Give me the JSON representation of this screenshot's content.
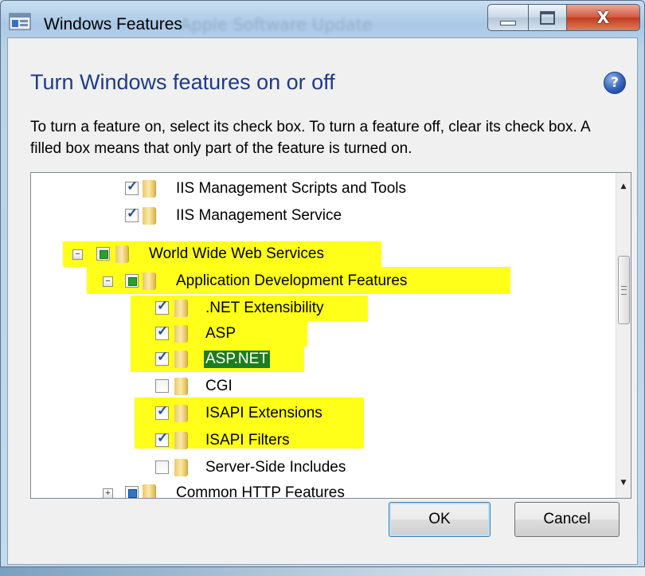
{
  "window": {
    "title": "Windows Features",
    "background_title": "Apple Software Update"
  },
  "dialog": {
    "heading": "Turn Windows features on or off",
    "description": "To turn a feature on, select its check box. To turn a feature off, clear its check box. A filled box means that only part of the feature is turned on."
  },
  "tree": {
    "items": [
      {
        "label": "IIS Management Scripts and Tools",
        "state": "checked"
      },
      {
        "label": "IIS Management Service",
        "state": "checked"
      },
      {
        "label": "World Wide Web Services",
        "state": "partial",
        "expander": "⊟"
      },
      {
        "label": "Application Development Features",
        "state": "partial",
        "expander": "⊟"
      },
      {
        "label": ".NET Extensibility",
        "state": "checked"
      },
      {
        "label": "ASP",
        "state": "checked"
      },
      {
        "label": "ASP.NET",
        "state": "checked"
      },
      {
        "label": "CGI",
        "state": "unchecked"
      },
      {
        "label": "ISAPI Extensions",
        "state": "checked"
      },
      {
        "label": "ISAPI Filters",
        "state": "checked"
      },
      {
        "label": "Server-Side Includes",
        "state": "unchecked"
      },
      {
        "label": "Common HTTP Features",
        "state": "partial",
        "expander": "⊞"
      }
    ]
  },
  "buttons": {
    "ok": "OK",
    "cancel": "Cancel"
  },
  "icons": {
    "help": "?",
    "close": "X",
    "scroll_up": "▲",
    "scroll_down": "▼"
  },
  "colors": {
    "heading": "#1e3a8a",
    "highlight": "#ffff1a",
    "selection": "#1e7d1e"
  }
}
